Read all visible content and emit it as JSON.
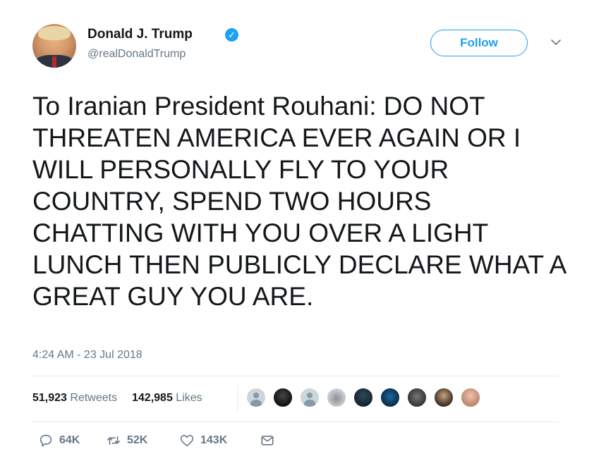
{
  "header": {
    "display_name": "Donald J. Trump",
    "handle": "@realDonaldTrump",
    "verified_icon": "verified-badge-icon",
    "follow_label": "Follow",
    "menu_icon": "chevron-down-icon"
  },
  "tweet": {
    "text": "To Iranian President Rouhani: DO NOT THREATEN AMERICA EVER AGAIN OR I WILL PERSONALLY FLY TO YOUR COUNTRY, SPEND TWO HOURS CHATTING WITH YOU OVER A LIGHT LUNCH THEN PUBLICLY DECLARE WHAT A GREAT GUY YOU ARE.",
    "timestamp": "4:24 AM - 23 Jul 2018"
  },
  "stats": {
    "retweets_count": "51,923",
    "retweets_label": "Retweets",
    "likes_count": "142,985",
    "likes_label": "Likes"
  },
  "actions": {
    "reply_count": "64K",
    "retweet_count": "52K",
    "like_count": "143K"
  },
  "colors": {
    "accent": "#1da1f2",
    "text": "#14171a",
    "secondary": "#657786",
    "divider": "#e6ecf0"
  }
}
